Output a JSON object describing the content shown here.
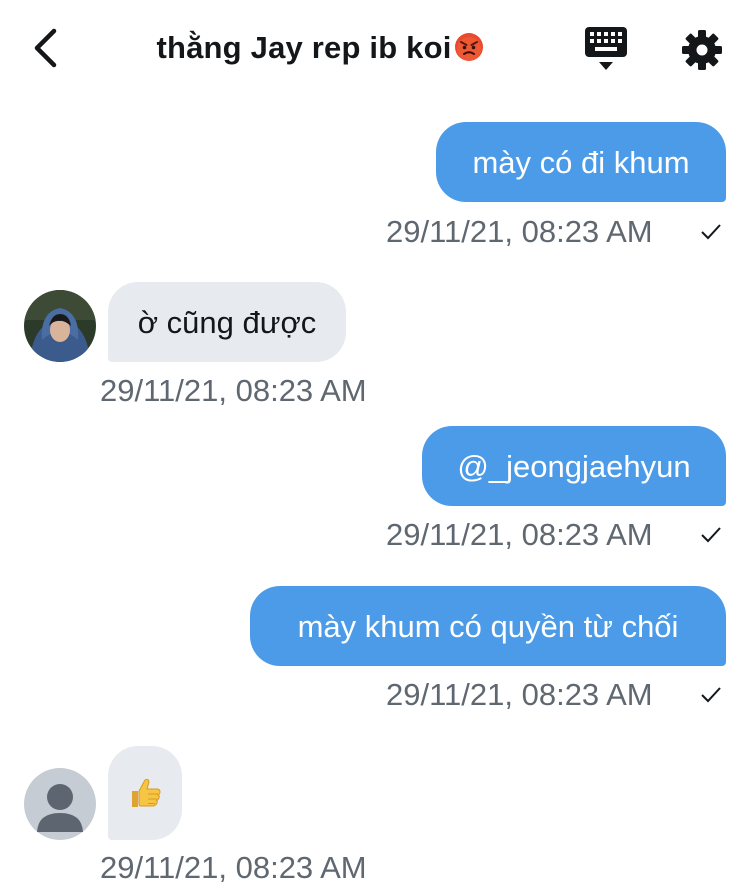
{
  "header": {
    "title": "thằng Jay rep ib koi",
    "title_emoji": "angry-face-emoji",
    "back_icon": "chevron-left-icon",
    "keyboard_icon": "keyboard-icon",
    "settings_icon": "gear-icon"
  },
  "colors": {
    "outgoing_bubble": "#4c9be8",
    "incoming_bubble": "#e7eaee",
    "timestamp_text": "#5f6770"
  },
  "messages": [
    {
      "direction": "outgoing",
      "text": "mày có đi khum",
      "time": "29/11/21, 08:23 AM",
      "seen": true
    },
    {
      "direction": "incoming",
      "text": "ờ cũng được",
      "time": "29/11/21, 08:23 AM",
      "avatar": "photo"
    },
    {
      "direction": "outgoing",
      "text": "@_jeongjaehyun",
      "time": "29/11/21, 08:23 AM",
      "seen": true
    },
    {
      "direction": "outgoing",
      "text": "mày khum có quyền từ chối",
      "time": "29/11/21, 08:23 AM",
      "seen": true
    },
    {
      "direction": "incoming",
      "text": "",
      "emoji": "thumbs-up-emoji",
      "time": "29/11/21, 08:23 AM",
      "avatar": "default"
    }
  ]
}
